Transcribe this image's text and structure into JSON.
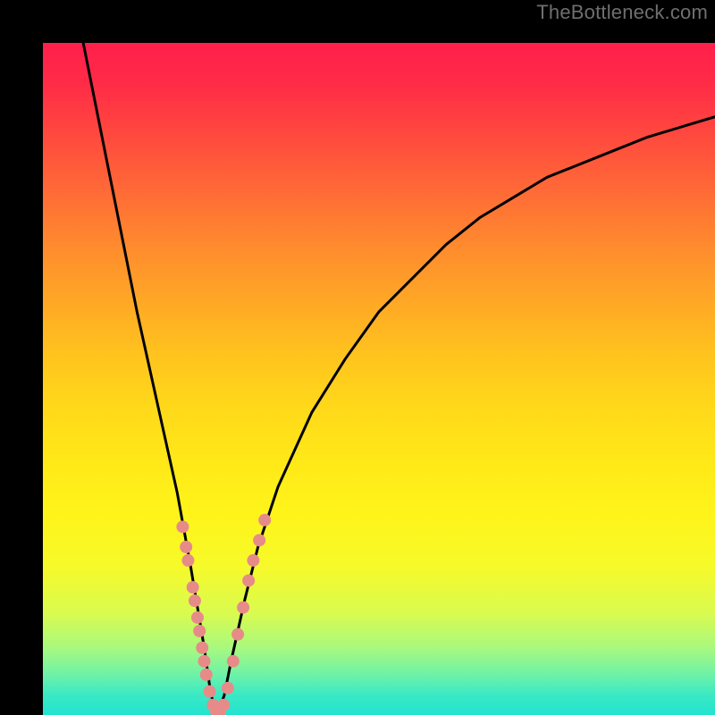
{
  "watermark": "TheBottleneck.com",
  "colors": {
    "background": "#000000",
    "curve_stroke": "#000000",
    "dot_fill": "#e78b88",
    "gradient_top": "#ff1f4b",
    "gradient_bottom": "#22e3d0"
  },
  "chart_data": {
    "type": "line",
    "title": "",
    "xlabel": "",
    "ylabel": "",
    "xlim": [
      0,
      100
    ],
    "ylim": [
      0,
      100
    ],
    "annotations": [
      "TheBottleneck.com"
    ],
    "description": "V-shaped bottleneck curve over rainbow gradient background; dots cluster near the valley minimum.",
    "series": [
      {
        "name": "bottleneck-curve",
        "x": [
          6,
          8,
          10,
          12,
          14,
          16,
          18,
          20,
          22,
          23,
          24,
          25,
          26,
          27,
          28,
          30,
          32,
          35,
          40,
          45,
          50,
          55,
          60,
          65,
          70,
          75,
          80,
          85,
          90,
          95,
          100
        ],
        "y": [
          100,
          90,
          80,
          70,
          60,
          51,
          42,
          33,
          22,
          16,
          10,
          3,
          0,
          3,
          8,
          17,
          25,
          34,
          45,
          53,
          60,
          65,
          70,
          74,
          77,
          80,
          82,
          84,
          86,
          87.5,
          89
        ]
      }
    ],
    "dots": [
      {
        "x": 20.8,
        "y": 28
      },
      {
        "x": 21.3,
        "y": 25
      },
      {
        "x": 21.6,
        "y": 23
      },
      {
        "x": 22.3,
        "y": 19
      },
      {
        "x": 22.6,
        "y": 17
      },
      {
        "x": 23.0,
        "y": 14.5
      },
      {
        "x": 23.3,
        "y": 12.5
      },
      {
        "x": 23.7,
        "y": 10
      },
      {
        "x": 24.0,
        "y": 8
      },
      {
        "x": 24.3,
        "y": 6
      },
      {
        "x": 24.8,
        "y": 3.5
      },
      {
        "x": 25.3,
        "y": 1.5
      },
      {
        "x": 25.8,
        "y": 0.5
      },
      {
        "x": 26.3,
        "y": 0.5
      },
      {
        "x": 26.9,
        "y": 1.5
      },
      {
        "x": 27.5,
        "y": 4
      },
      {
        "x": 28.3,
        "y": 8
      },
      {
        "x": 29.0,
        "y": 12
      },
      {
        "x": 29.8,
        "y": 16
      },
      {
        "x": 30.6,
        "y": 20
      },
      {
        "x": 31.3,
        "y": 23
      },
      {
        "x": 32.2,
        "y": 26
      },
      {
        "x": 33.0,
        "y": 29
      }
    ]
  }
}
